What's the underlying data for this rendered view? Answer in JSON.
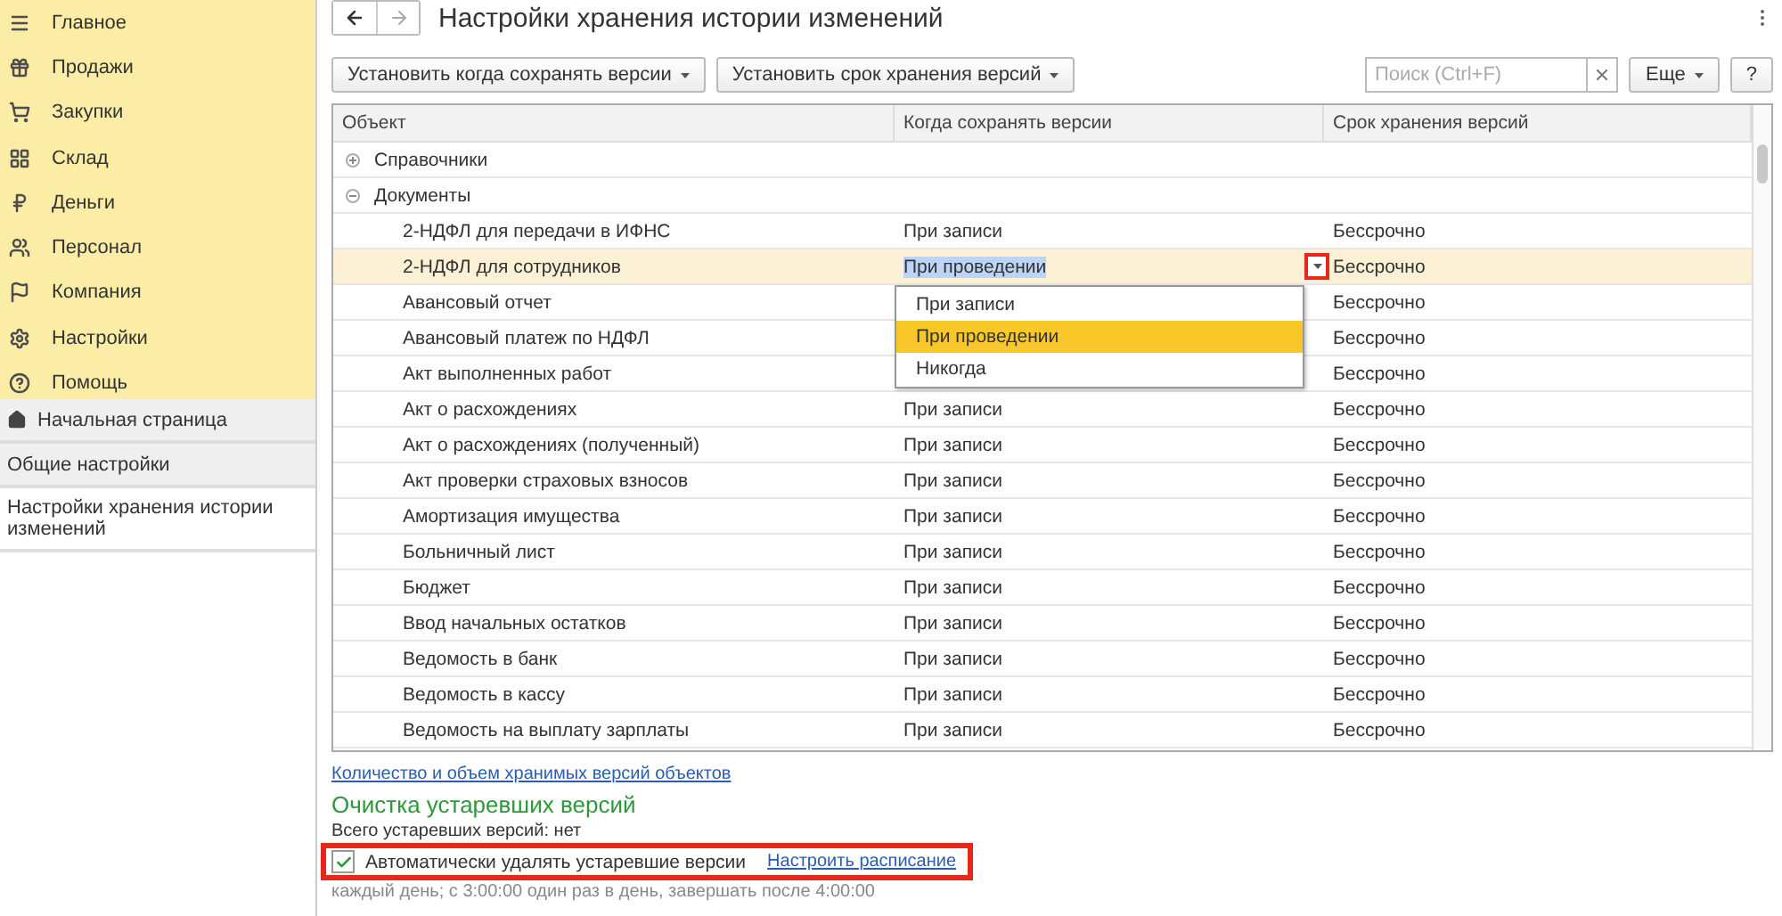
{
  "sections_panel": {
    "items": [
      {
        "label": "Главное"
      },
      {
        "label": "Продажи"
      },
      {
        "label": "Закупки"
      },
      {
        "label": "Склад"
      },
      {
        "label": "Деньги"
      },
      {
        "label": "Персонал"
      },
      {
        "label": "Компания"
      },
      {
        "label": "Настройки"
      },
      {
        "label": "Помощь"
      }
    ]
  },
  "open_pages": [
    {
      "label": "Начальная страница",
      "kind": "home",
      "selected": false
    },
    {
      "label": "Общие настройки",
      "kind": "page",
      "selected": false
    },
    {
      "label": "Настройки хранения истории изменений",
      "kind": "page",
      "selected": true
    }
  ],
  "window": {
    "title": "Настройки хранения истории изменений"
  },
  "toolbar": {
    "buttons": [
      "Установить когда сохранять версии",
      "Установить срок хранения версий"
    ],
    "search": {
      "placeholder": "Поиск (Ctrl+F)"
    },
    "more": "Еще",
    "help": "?"
  },
  "table": {
    "columns": [
      "Объект",
      "Когда сохранять версии",
      "Срок хранения версий"
    ],
    "groups": [
      {
        "label": "Справочники",
        "expanded": false
      },
      {
        "label": "Документы",
        "expanded": true,
        "children": [
          {
            "object": "2-НДФЛ для передачи в ИФНС",
            "when": "При записи",
            "term": "Бессрочно",
            "selected": false
          },
          {
            "object": "2-НДФЛ для сотрудников",
            "when": "При проведении",
            "term": "Бессрочно",
            "selected": true
          },
          {
            "object": "Авансовый отчет",
            "term": "Бессрочно",
            "selected": false
          },
          {
            "object": "Авансовый платеж по НДФЛ",
            "term": "Бессрочно",
            "selected": false
          },
          {
            "object": "Акт выполненных работ",
            "term": "Бессрочно",
            "selected": false
          },
          {
            "object": "Акт о расхождениях",
            "when": "При записи",
            "term": "Бессрочно",
            "selected": false
          },
          {
            "object": "Акт о расхождениях (полученный)",
            "when": "При записи",
            "term": "Бессрочно",
            "selected": false
          },
          {
            "object": "Акт проверки страховых взносов",
            "when": "При записи",
            "term": "Бессрочно",
            "selected": false
          },
          {
            "object": "Амортизация имущества",
            "when": "При записи",
            "term": "Бессрочно",
            "selected": false
          },
          {
            "object": "Больничный лист",
            "when": "При записи",
            "term": "Бессрочно",
            "selected": false
          },
          {
            "object": "Бюджет",
            "when": "При записи",
            "term": "Бессрочно",
            "selected": false
          },
          {
            "object": "Ввод начальных остатков",
            "when": "При записи",
            "term": "Бессрочно",
            "selected": false
          },
          {
            "object": "Ведомость в банк",
            "when": "При записи",
            "term": "Бессрочно",
            "selected": false
          },
          {
            "object": "Ведомость в кассу",
            "when": "При записи",
            "term": "Бессрочно",
            "selected": false
          },
          {
            "object": "Ведомость на выплату зарплаты",
            "when": "При записи",
            "term": "Бессрочно",
            "selected": false
          }
        ]
      }
    ],
    "dropdown": [
      {
        "label": "При записи",
        "selected": false
      },
      {
        "label": "При проведении",
        "selected": true
      },
      {
        "label": "Никогда",
        "selected": false
      }
    ]
  },
  "versions_link": "Количество и объем хранимых версий объектов",
  "cleanup": {
    "heading": "Очистка устаревших версий",
    "total": "Всего устаревших версий: нет",
    "auto_delete": {
      "label": "Автоматически удалять устаревшие версии",
      "checked": true
    },
    "schedule_link": "Настроить расписание",
    "schedule": "каждый день; с 3:00:00 один раз в день, завершать после 4:00:00"
  }
}
